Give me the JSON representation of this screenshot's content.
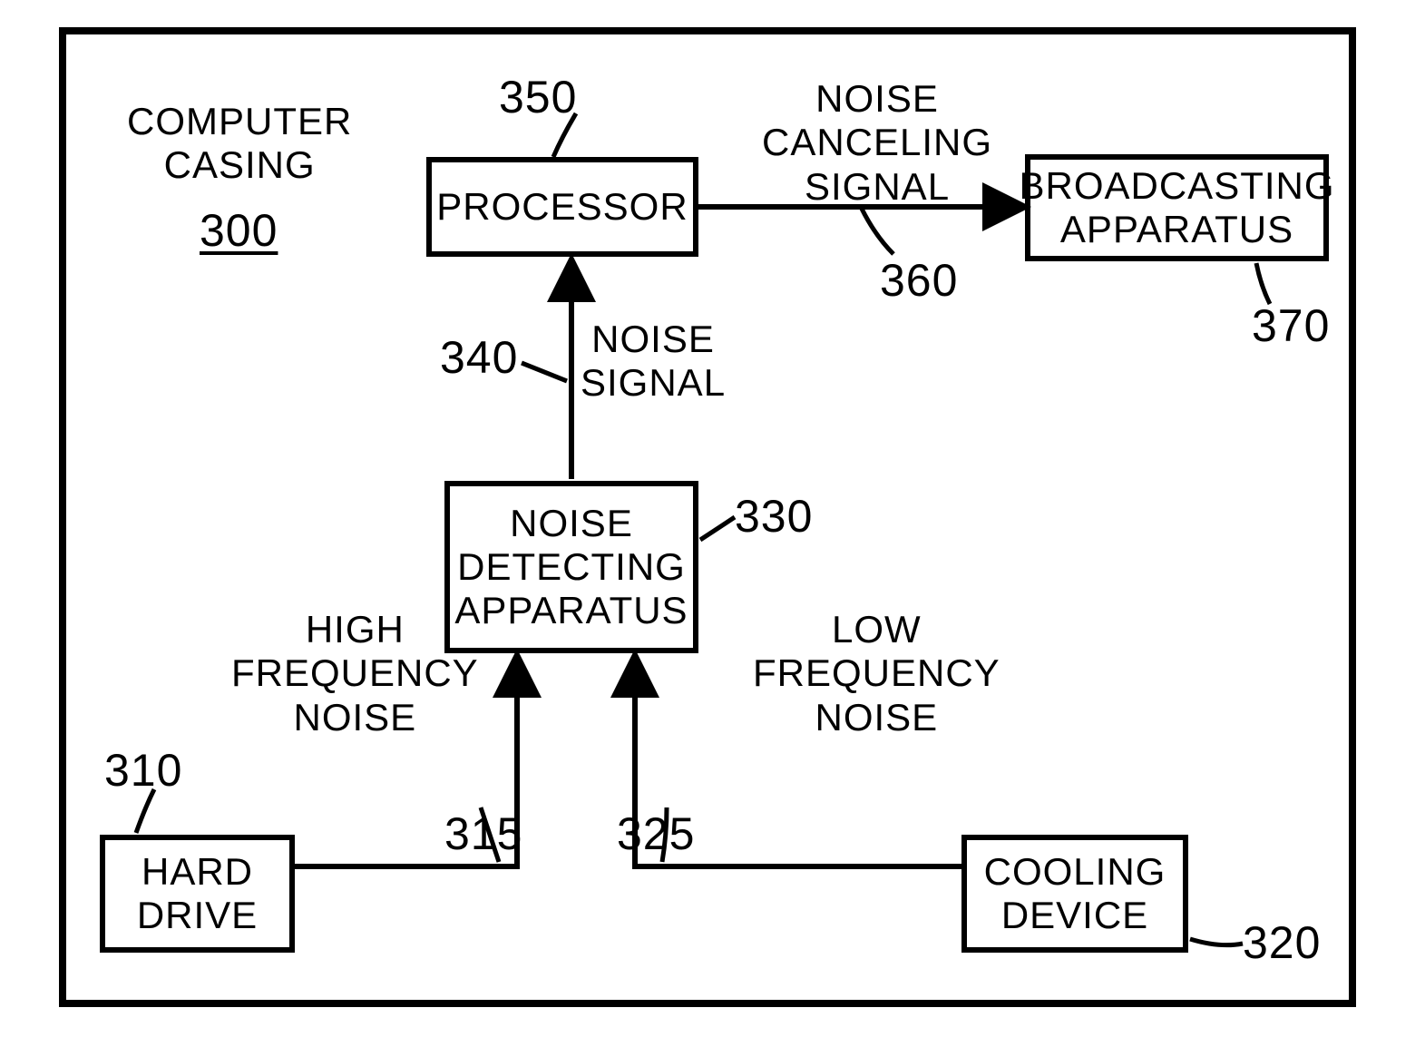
{
  "casing": {
    "label": "COMPUTER\nCASING",
    "ref": "300"
  },
  "blocks": {
    "processor": {
      "label": "PROCESSOR",
      "ref": "350"
    },
    "broadcast": {
      "label": "BROADCASTING\nAPPARATUS",
      "ref": "370"
    },
    "detector": {
      "label": "NOISE\nDETECTING\nAPPARATUS",
      "ref": "330"
    },
    "harddrive": {
      "label": "HARD\nDRIVE",
      "ref": "310"
    },
    "cooling": {
      "label": "COOLING\nDEVICE",
      "ref": "320"
    }
  },
  "signals": {
    "hf_noise": {
      "label": "HIGH\nFREQUENCY\nNOISE",
      "ref": "315"
    },
    "lf_noise": {
      "label": "LOW\nFREQUENCY\nNOISE",
      "ref": "325"
    },
    "noise_signal": {
      "label": "NOISE\nSIGNAL",
      "ref": "340"
    },
    "cancel_signal": {
      "label": "NOISE\nCANCELING\nSIGNAL",
      "ref": "360"
    }
  }
}
